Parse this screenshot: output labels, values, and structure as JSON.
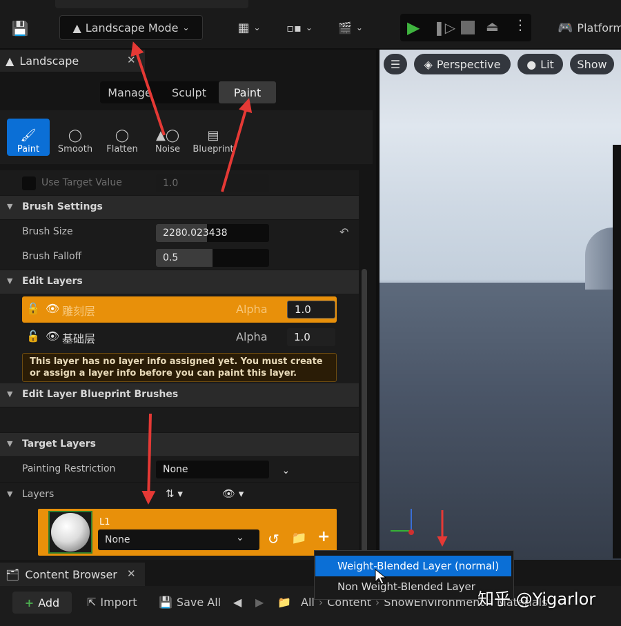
{
  "toolbar": {
    "mode_label": "Landscape Mode",
    "platforms_label": "Platform"
  },
  "panel": {
    "title": "Landscape",
    "tabs": [
      {
        "label": "Manage",
        "active": false
      },
      {
        "label": "Sculpt",
        "active": false
      },
      {
        "label": "Paint",
        "active": true
      }
    ],
    "tools": [
      {
        "label": "Paint",
        "active": true
      },
      {
        "label": "Smooth",
        "active": false
      },
      {
        "label": "Flatten",
        "active": false
      },
      {
        "label": "Noise",
        "active": false
      },
      {
        "label": "Blueprint",
        "active": false
      }
    ],
    "use_target_value": {
      "label": "Use Target Value",
      "value": "1.0"
    },
    "brush_settings": {
      "title": "Brush Settings",
      "size_label": "Brush Size",
      "size_value": "2280.023438",
      "size_fraction": 0.45,
      "falloff_label": "Brush Falloff",
      "falloff_value": "0.5",
      "falloff_fraction": 0.5
    },
    "edit_layers": {
      "title": "Edit Layers",
      "layers": [
        {
          "name": "雕刻层",
          "alpha_label": "Alpha",
          "alpha": "1.0",
          "selected": true
        },
        {
          "name": "基础层",
          "alpha_label": "Alpha",
          "alpha": "1.0",
          "selected": false
        }
      ],
      "warning": "This layer has no layer info assigned yet. You must create or assign a layer info before you can paint this layer."
    },
    "edit_layer_blueprint_brushes": {
      "title": "Edit Layer Blueprint Brushes"
    },
    "target_layers": {
      "title": "Target Layers",
      "painting_restriction_label": "Painting Restriction",
      "painting_restriction_value": "None",
      "layers_label": "Layers",
      "layer_item": {
        "name": "L1",
        "info_value": "None"
      }
    }
  },
  "viewport": {
    "perspective_label": "Perspective",
    "lit_label": "Lit",
    "show_label": "Show"
  },
  "context_menu": {
    "items": [
      {
        "label": "Weight-Blended Layer (normal)",
        "highlighted": true
      },
      {
        "label": "Non Weight-Blended Layer",
        "highlighted": false
      }
    ]
  },
  "content_browser": {
    "title": "Content Browser",
    "add_label": "Add",
    "import_label": "Import",
    "save_all_label": "Save All",
    "breadcrumb": [
      "All",
      "Content",
      "ShowEnvironment",
      "Materials"
    ]
  },
  "watermark": "知乎 @Yigarlor",
  "colors": {
    "accent_orange": "#e8900a",
    "selection_blue": "#0b6fd6",
    "annotation_red": "#e53935"
  }
}
